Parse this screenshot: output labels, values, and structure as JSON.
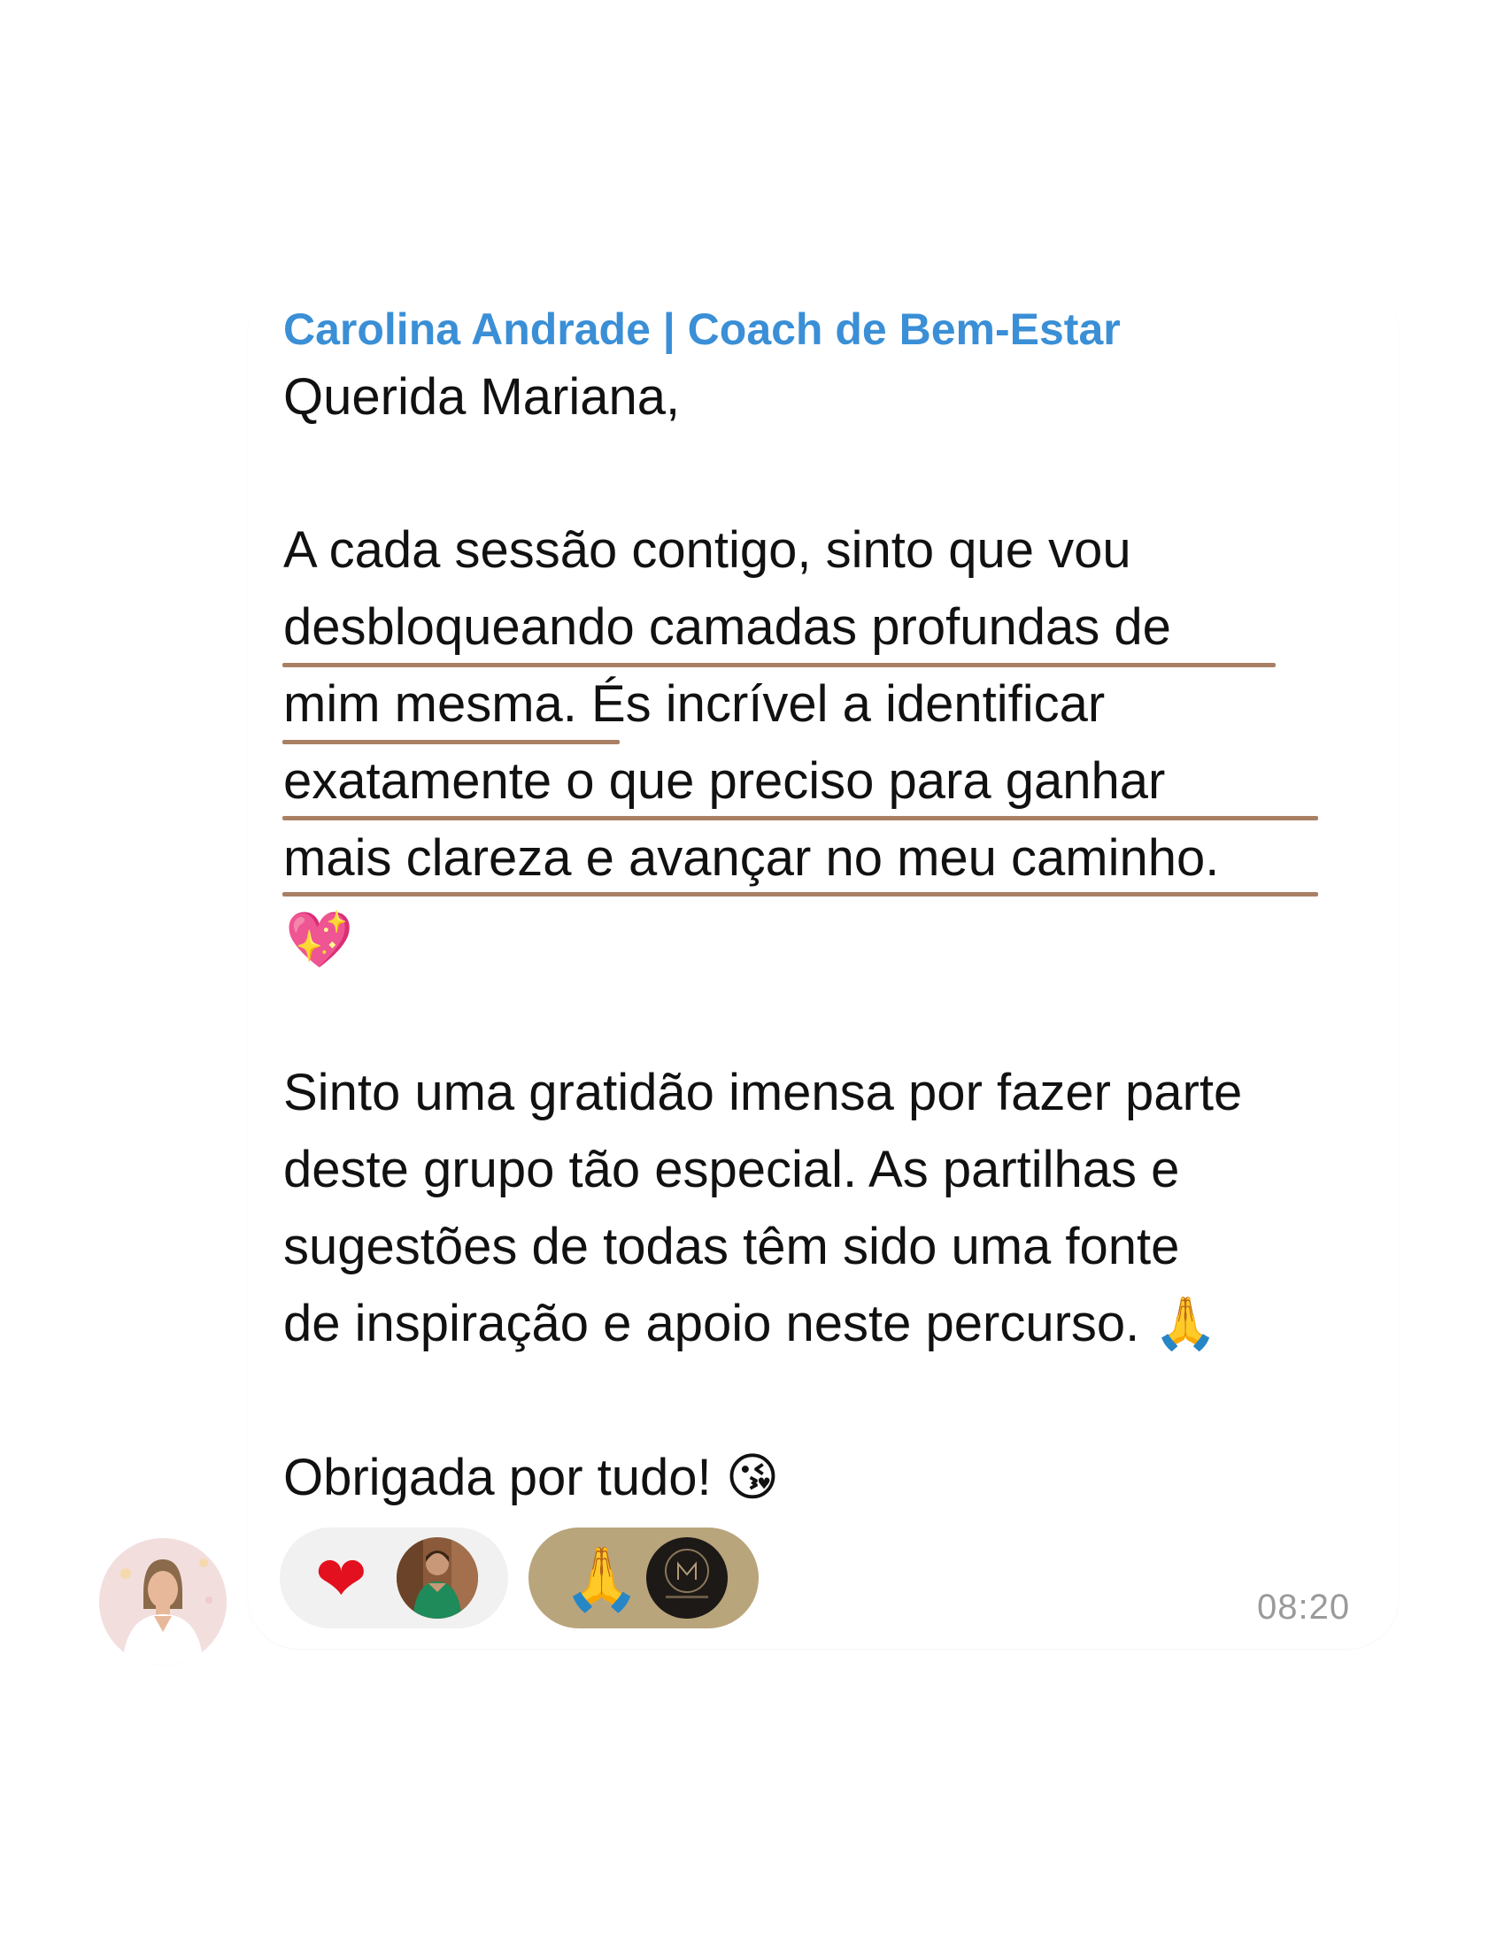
{
  "message": {
    "sender": "Carolina Andrade | Coach de Bem-Estar",
    "greeting": "Querida Mariana,",
    "paragraph1_lines": [
      "A cada sessão contigo, sinto que vou",
      "desbloqueando camadas profundas de",
      "mim mesma. És incrível a identificar",
      "exatamente o que preciso para ganhar",
      "mais clareza e avançar no meu caminho."
    ],
    "paragraph1_emoji": "💖",
    "paragraph2_lines": [
      "Sinto uma gratidão imensa por fazer parte",
      "deste grupo tão especial. As partilhas e",
      "sugestões de todas têm sido uma fonte",
      "de inspiração e apoio neste percurso. 🙏"
    ],
    "closing": "Obrigada por tudo! 😘",
    "time": "08:20"
  },
  "reactions": [
    {
      "emoji": "❤",
      "icon": "heart-icon",
      "color": "#e3101f"
    },
    {
      "emoji": "🙏",
      "icon": "praying-hands-icon",
      "color": "#b9a57c"
    }
  ],
  "colors": {
    "sender": "#3a8fd6",
    "underline": "#a98064",
    "text": "#111111",
    "timestamp": "#9a9a9a"
  }
}
